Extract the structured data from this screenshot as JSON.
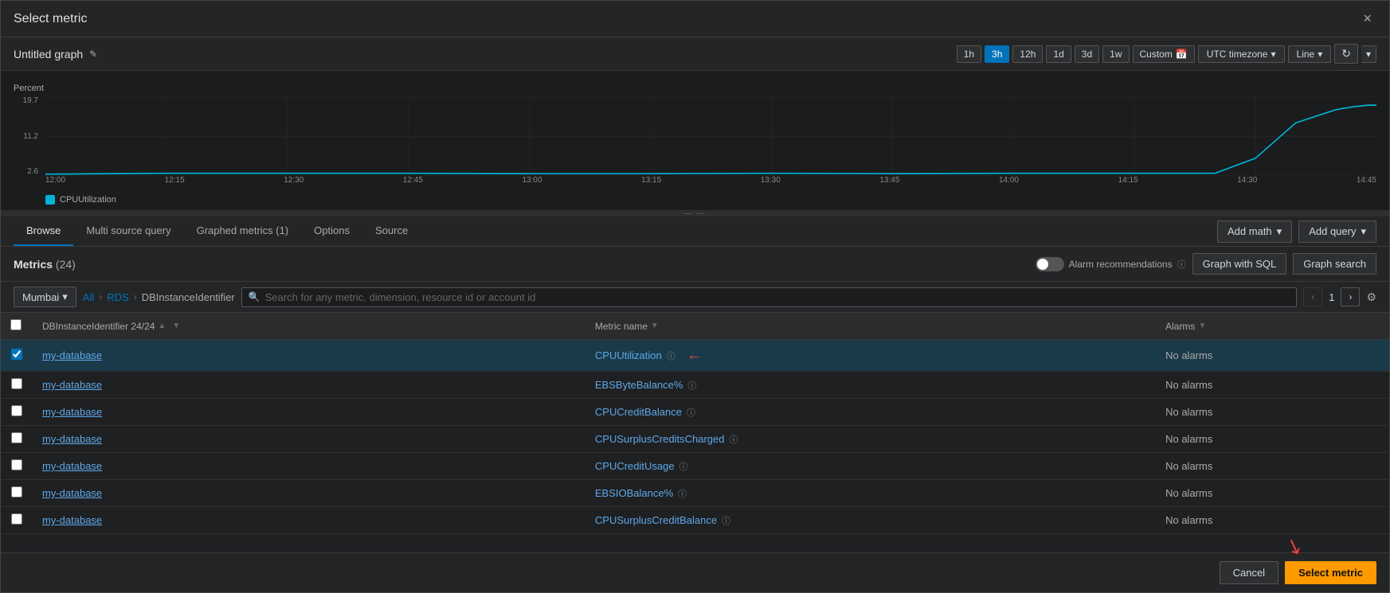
{
  "modal": {
    "title": "Select metric",
    "close_label": "×"
  },
  "graph": {
    "title": "Untitled graph",
    "edit_icon": "✎",
    "time_buttons": [
      {
        "label": "1h",
        "active": false
      },
      {
        "label": "3h",
        "active": true
      },
      {
        "label": "12h",
        "active": false
      },
      {
        "label": "1d",
        "active": false
      },
      {
        "label": "3d",
        "active": false
      },
      {
        "label": "1w",
        "active": false
      }
    ],
    "custom_label": "Custom",
    "timezone_label": "UTC timezone",
    "line_label": "Line",
    "refresh_icon": "↻"
  },
  "chart": {
    "y_label": "Percent",
    "y_ticks": [
      "19.7",
      "11.2",
      "2.6"
    ],
    "x_ticks": [
      "12:00",
      "12:15",
      "12:30",
      "12:45",
      "13:00",
      "13:15",
      "13:30",
      "13:45",
      "14:00",
      "14:15",
      "14:30",
      "14:45"
    ],
    "legend": "CPUUtilization"
  },
  "tabs": {
    "items": [
      {
        "label": "Browse",
        "active": true
      },
      {
        "label": "Multi source query",
        "active": false
      },
      {
        "label": "Graphed metrics (1)",
        "active": false
      },
      {
        "label": "Options",
        "active": false
      },
      {
        "label": "Source",
        "active": false
      }
    ],
    "add_math_label": "Add math",
    "add_query_label": "Add query"
  },
  "metrics_section": {
    "title": "Metrics",
    "count": "(24)",
    "alarm_recommendations_label": "Alarm recommendations",
    "graph_with_sql_label": "Graph with SQL",
    "graph_search_label": "Graph search",
    "region_label": "Mumbai",
    "breadcrumbs": [
      {
        "label": "All",
        "link": true
      },
      {
        "label": "RDS",
        "link": true
      },
      {
        "label": "DBInstanceIdentifier",
        "link": false
      }
    ],
    "search_placeholder": "Search for any metric, dimension, resource id or account id",
    "page_current": "1",
    "columns": [
      {
        "label": "DBInstanceIdentifier 24/24",
        "sortable": true
      },
      {
        "label": "Metric name",
        "sortable": true
      },
      {
        "label": "Alarms",
        "filterable": true
      }
    ],
    "rows": [
      {
        "checked": true,
        "selected": true,
        "db_instance": "my-database",
        "metric_name": "CPUUtilization",
        "alarms": "No alarms",
        "has_arrow": true
      },
      {
        "checked": false,
        "selected": false,
        "db_instance": "my-database",
        "metric_name": "EBSByteBalance%",
        "alarms": "No alarms",
        "has_arrow": false
      },
      {
        "checked": false,
        "selected": false,
        "db_instance": "my-database",
        "metric_name": "CPUCreditBalance",
        "alarms": "No alarms",
        "has_arrow": false
      },
      {
        "checked": false,
        "selected": false,
        "db_instance": "my-database",
        "metric_name": "CPUSurplusCreditsCharged",
        "alarms": "No alarms",
        "has_arrow": false
      },
      {
        "checked": false,
        "selected": false,
        "db_instance": "my-database",
        "metric_name": "CPUCreditUsage",
        "alarms": "No alarms",
        "has_arrow": false
      },
      {
        "checked": false,
        "selected": false,
        "db_instance": "my-database",
        "metric_name": "EBSIOBalance%",
        "alarms": "No alarms",
        "has_arrow": false
      },
      {
        "checked": false,
        "selected": false,
        "db_instance": "my-database",
        "metric_name": "CPUSurplusCreditBalance",
        "alarms": "No alarms",
        "has_arrow": false
      }
    ]
  },
  "footer": {
    "cancel_label": "Cancel",
    "select_label": "Select metric"
  }
}
